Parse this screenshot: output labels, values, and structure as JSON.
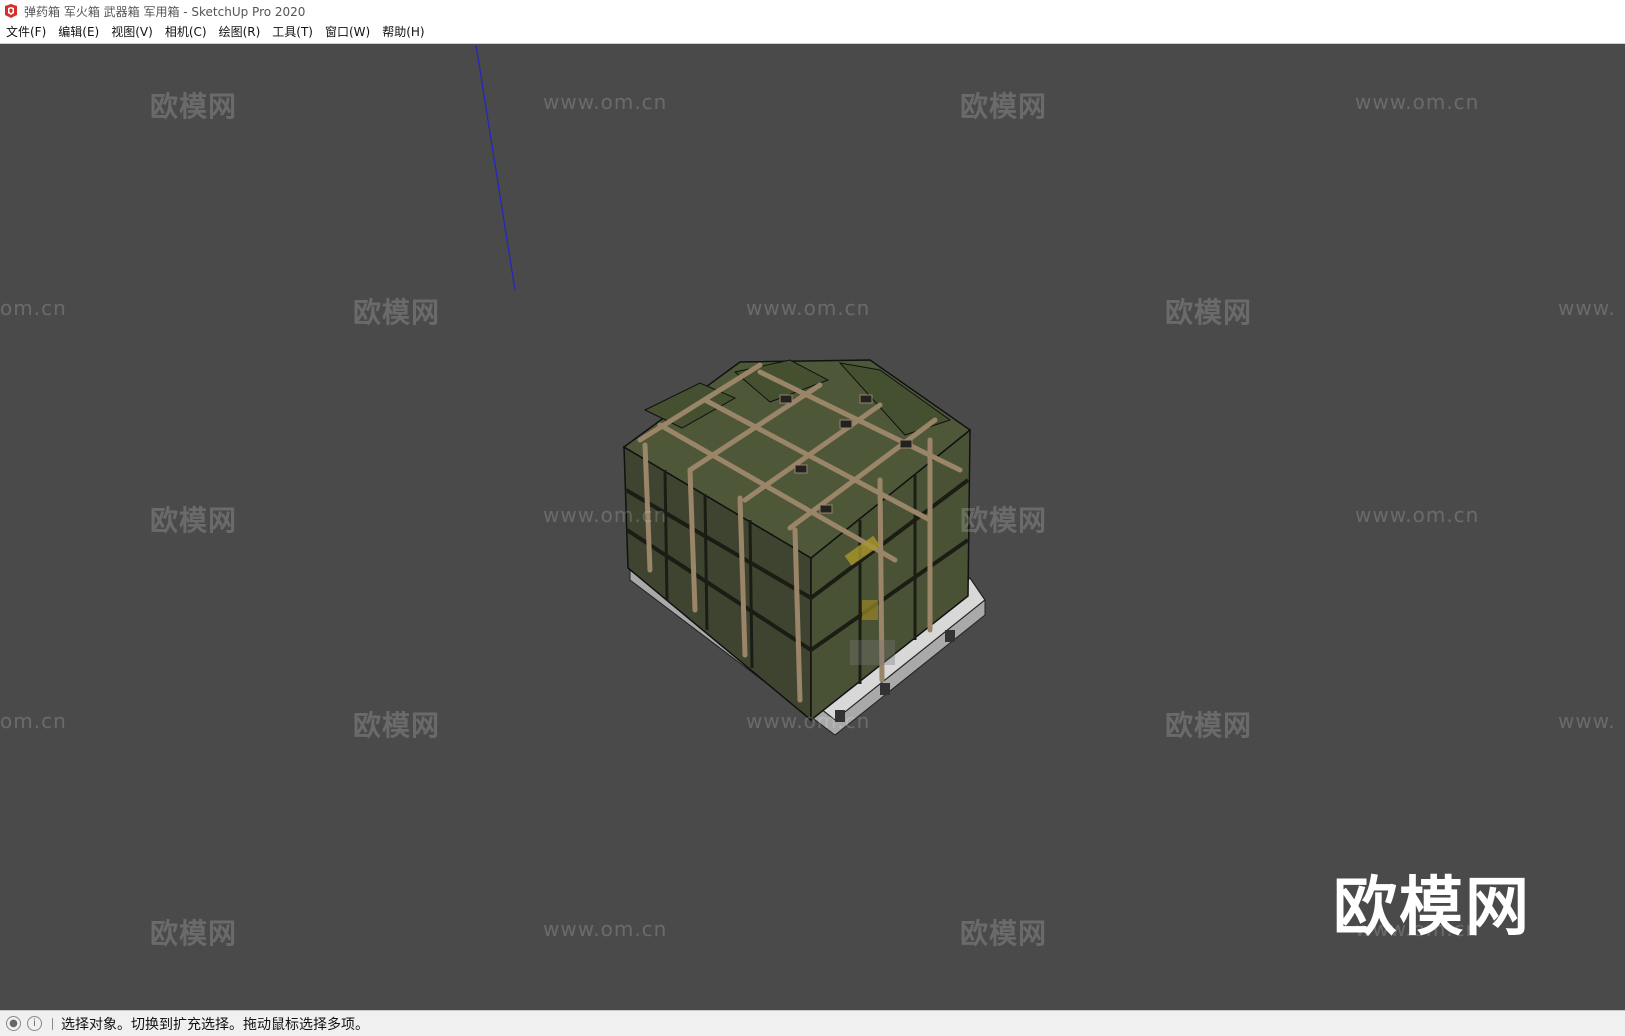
{
  "window": {
    "title": "弹药箱 军火箱 武器箱 军用箱 - SketchUp Pro 2020",
    "app_icon": "sketchup-icon",
    "accent_color": "#d6302a"
  },
  "menubar": {
    "items": [
      {
        "label": "文件(F)"
      },
      {
        "label": "编辑(E)"
      },
      {
        "label": "视图(V)"
      },
      {
        "label": "相机(C)"
      },
      {
        "label": "绘图(R)"
      },
      {
        "label": "工具(T)"
      },
      {
        "label": "窗口(W)"
      },
      {
        "label": "帮助(H)"
      }
    ]
  },
  "viewport": {
    "background": "#4a4a4a",
    "model": "military ammo crates strapped on pallet",
    "axis_color": "#2020c8"
  },
  "watermarks": {
    "cn_text": "欧模网",
    "url_text": "www.om.cn",
    "partial_url_left": "om.cn",
    "partial_url_right": "www.",
    "big_text": "欧模网"
  },
  "statusbar": {
    "icon_1": "geolocation-icon",
    "icon_2": "info-icon",
    "text": "选择对象。切换到扩充选择。拖动鼠标选择多项。"
  }
}
